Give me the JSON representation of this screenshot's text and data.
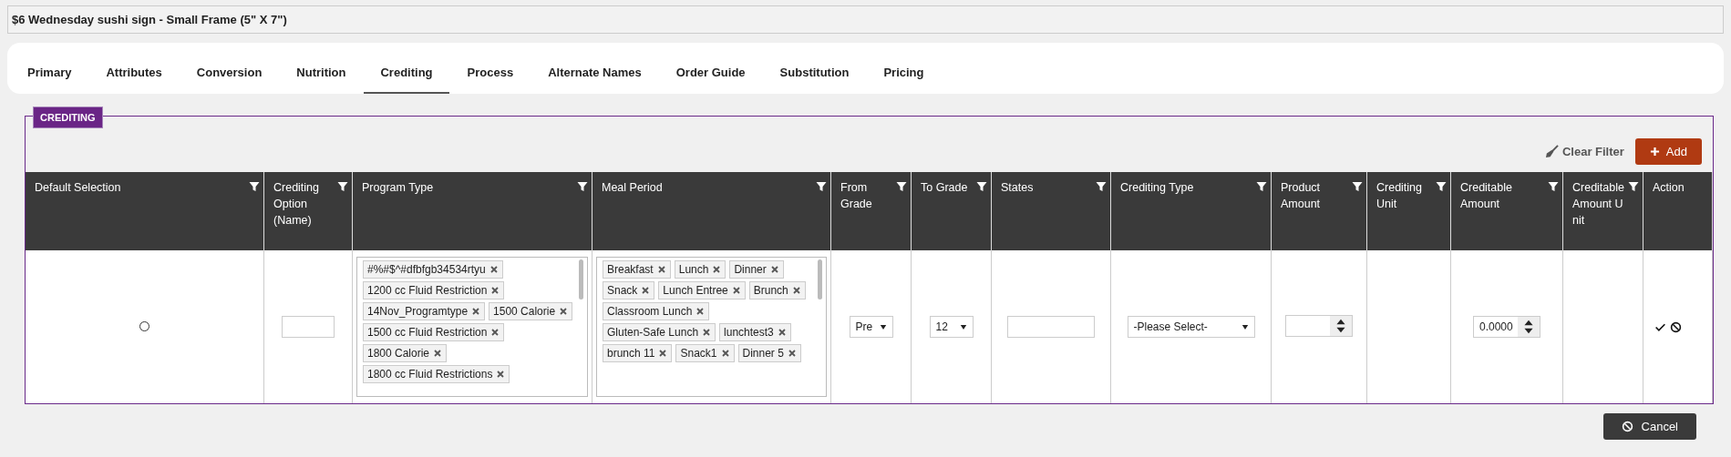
{
  "window": {
    "title": "$6 Wednesday sushi sign - Small Frame (5\" X 7\")"
  },
  "tabs": [
    {
      "label": "Primary",
      "selected": false
    },
    {
      "label": "Attributes",
      "selected": false
    },
    {
      "label": "Conversion",
      "selected": false
    },
    {
      "label": "Nutrition",
      "selected": false
    },
    {
      "label": "Crediting",
      "selected": true
    },
    {
      "label": "Process",
      "selected": false
    },
    {
      "label": "Alternate Names",
      "selected": false
    },
    {
      "label": "Order Guide",
      "selected": false
    },
    {
      "label": "Substitution",
      "selected": false
    },
    {
      "label": "Pricing",
      "selected": false
    }
  ],
  "section": {
    "legend": "CREDITING",
    "clear_filter": "Clear Filter",
    "add_button": "Add"
  },
  "table": {
    "columns": [
      {
        "label": "Default Selection",
        "filter": true
      },
      {
        "label": "Crediting Option (Name)",
        "filter": true
      },
      {
        "label": "Program Type",
        "filter": true
      },
      {
        "label": "Meal Period",
        "filter": true
      },
      {
        "label": "From Grade",
        "filter": true
      },
      {
        "label": "To Grade",
        "filter": true
      },
      {
        "label": "States",
        "filter": true
      },
      {
        "label": "Crediting Type",
        "filter": true
      },
      {
        "label": "Product Amount",
        "filter": true
      },
      {
        "label": "Crediting Unit",
        "filter": true
      },
      {
        "label": "Creditable Amount",
        "filter": true
      },
      {
        "label": "Creditable Amount Unit",
        "filter": true
      },
      {
        "label": "Action",
        "filter": false
      }
    ],
    "rows": [
      {
        "default_selected": false,
        "program_types": [
          "#%#$^#dfbfgb34534rtyu",
          "1200 cc Fluid Restriction",
          "14Nov_Programtype",
          "1500 Calorie",
          "1500 cc Fluid Restriction",
          "1800 Calorie",
          "1800 cc Fluid Restrictions"
        ],
        "meal_periods": [
          "Breakfast",
          "Lunch",
          "Dinner",
          "Snack",
          "Lunch Entree",
          "Brunch",
          "Classroom Lunch",
          "Gluten-Safe Lunch",
          "lunchtest3",
          "brunch 11",
          "Snack1",
          "Dinner 5"
        ],
        "from_grade": "Pre",
        "to_grade": "12",
        "crediting_type": "-Please Select-",
        "creditable_amount": "0.0000"
      }
    ]
  },
  "footer": {
    "cancel_button": "Cancel"
  }
}
